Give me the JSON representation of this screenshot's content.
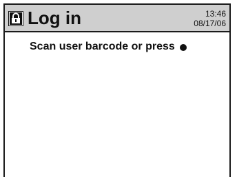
{
  "header": {
    "icon": "lock-icon",
    "title": "Log in",
    "time": "13:46",
    "date": "08/17/06",
    "background_color": "#cfcfcf"
  },
  "main": {
    "prompt": "Scan user barcode or press",
    "prompt_button_icon": "round-button-icon"
  }
}
